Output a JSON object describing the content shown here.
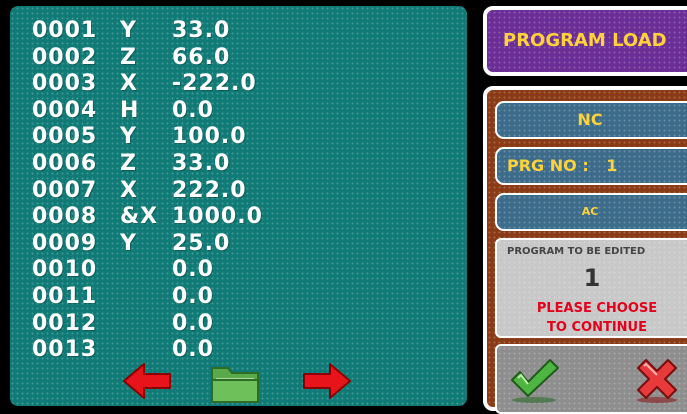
{
  "program_lines": [
    {
      "num": "0001",
      "axis": "Y",
      "value": "33.0"
    },
    {
      "num": "0002",
      "axis": "Z",
      "value": "66.0"
    },
    {
      "num": "0003",
      "axis": "X",
      "value": "-222.0"
    },
    {
      "num": "0004",
      "axis": "H",
      "value": "0.0"
    },
    {
      "num": "0005",
      "axis": "Y",
      "value": "100.0"
    },
    {
      "num": "0006",
      "axis": "Z",
      "value": "33.0"
    },
    {
      "num": "0007",
      "axis": "X",
      "value": "222.0"
    },
    {
      "num": "0008",
      "axis": "&X",
      "value": "1000.0"
    },
    {
      "num": "0009",
      "axis": "Y",
      "value": "25.0"
    },
    {
      "num": "0010",
      "axis": "",
      "value": "0.0"
    },
    {
      "num": "0011",
      "axis": "",
      "value": "0.0"
    },
    {
      "num": "0012",
      "axis": "",
      "value": "0.0"
    },
    {
      "num": "0013",
      "axis": "",
      "value": "0.0"
    }
  ],
  "nav": {
    "prev_icon": "red-left-arrow-icon",
    "folder_icon": "green-folder-icon",
    "next_icon": "red-right-arrow-icon"
  },
  "side": {
    "load_label": "PROGRAM LOAD",
    "nc_label": "NC",
    "prgno_label": "PRG NO :",
    "prgno_value": "1",
    "ac_label": "AC",
    "edit_title": "PROGRAM TO BE EDITED",
    "edit_number": "1",
    "edit_msg_line1": "PLEASE CHOOSE",
    "edit_msg_line2": "TO CONTINUE",
    "ok_icon": "green-checkmark-icon",
    "cancel_icon": "red-x-icon"
  },
  "colors": {
    "program_panel": "#0f7a76",
    "side_panel": "#8a3a15",
    "load_button": "#6b2d96",
    "side_button": "#3c6c8a",
    "label_yellow": "#ffd23a",
    "alert_red": "#e3001b"
  }
}
